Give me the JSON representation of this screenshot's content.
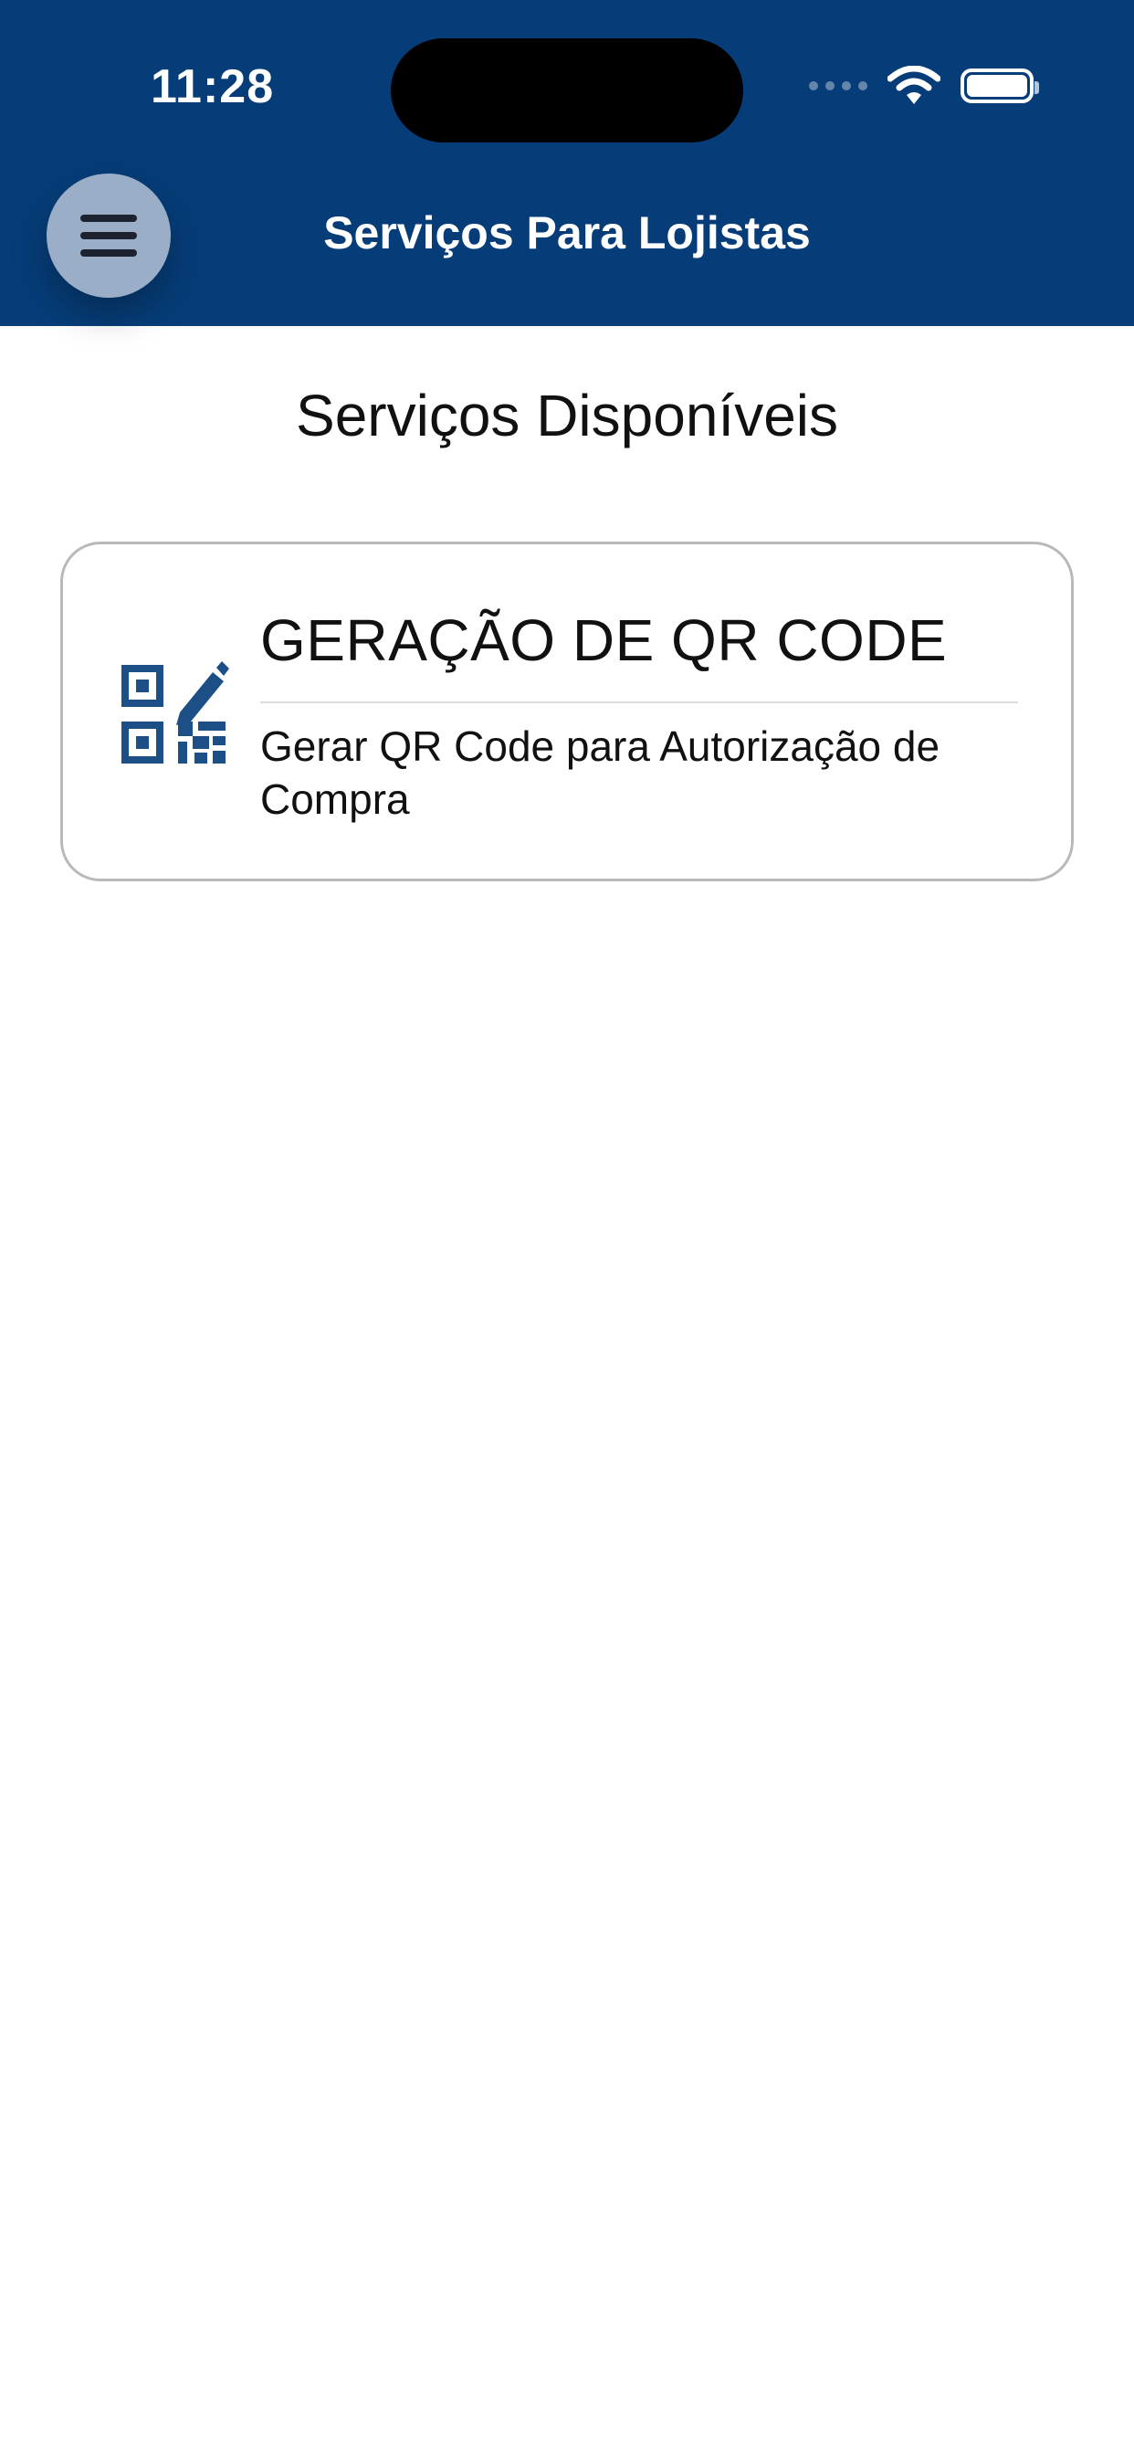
{
  "status_bar": {
    "time": "11:28"
  },
  "header": {
    "title": "Serviços Para Lojistas"
  },
  "main": {
    "section_title": "Serviços Disponíveis",
    "services": [
      {
        "title": "GERAÇÃO DE QR CODE",
        "description": "Gerar QR Code para Autorização de Compra",
        "icon": "qr-code-edit-icon"
      }
    ]
  },
  "colors": {
    "header_bg": "#063d78",
    "icon": "#1d4f87",
    "menu_button": "#9aaec8"
  }
}
